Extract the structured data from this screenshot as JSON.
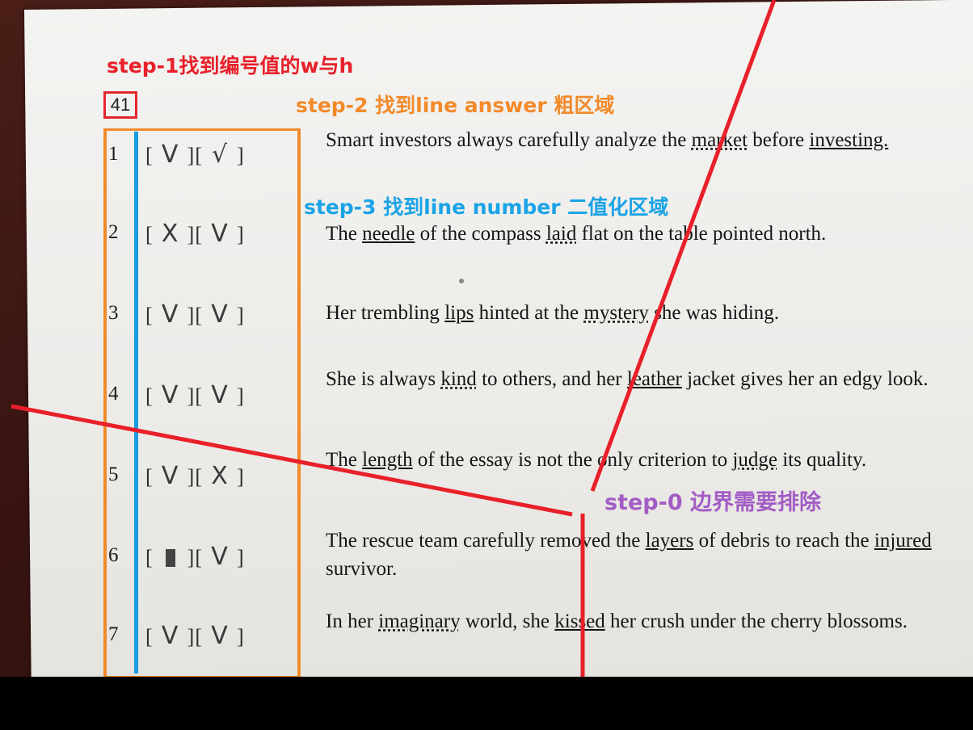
{
  "annotations": {
    "step1": "step-1找到编号值的w与h",
    "step2": "step-2 找到line answer 粗区域",
    "step3": "step-3 找到line number 二值化区域",
    "step0": "step-0 边界需要排除"
  },
  "question_number": "41",
  "rows": [
    {
      "num": "1",
      "mark1": "V",
      "mark2": "√",
      "parts": [
        "Smart investors always carefully analyze the ",
        "market",
        " before ",
        "investing.",
        ""
      ]
    },
    {
      "num": "2",
      "mark1": "X",
      "mark2": "V",
      "parts": [
        "The ",
        "needle",
        " of the compass ",
        "laid",
        " flat on the table pointed north."
      ]
    },
    {
      "num": "3",
      "mark1": "V",
      "mark2": "V",
      "parts": [
        "Her trembling ",
        "lips",
        " hinted at the ",
        "mystery",
        " she was hiding."
      ]
    },
    {
      "num": "4",
      "mark1": "V",
      "mark2": "V",
      "parts": [
        "She is always ",
        "kind",
        " to others, and her ",
        "leather",
        " jacket gives her an edgy look."
      ]
    },
    {
      "num": "5",
      "mark1": "V",
      "mark2": "X",
      "parts": [
        "The ",
        "length",
        " of the essay is not the only criterion to ",
        "judge",
        " its quality."
      ]
    },
    {
      "num": "6",
      "mark1": "",
      "mark2": "V",
      "parts": [
        "The rescue team carefully removed the ",
        "layers",
        " of debris to reach the ",
        "injured",
        " survivor."
      ]
    },
    {
      "num": "7",
      "mark1": "V",
      "mark2": "V",
      "parts": [
        "In her ",
        "imaginary",
        " world, she ",
        "kissed",
        " her crush under the cherry blossoms."
      ]
    }
  ],
  "colors": {
    "red": "#e8202a",
    "orange": "#f28a2b",
    "blue": "#1c9be0",
    "purple": "#a35cc4"
  }
}
